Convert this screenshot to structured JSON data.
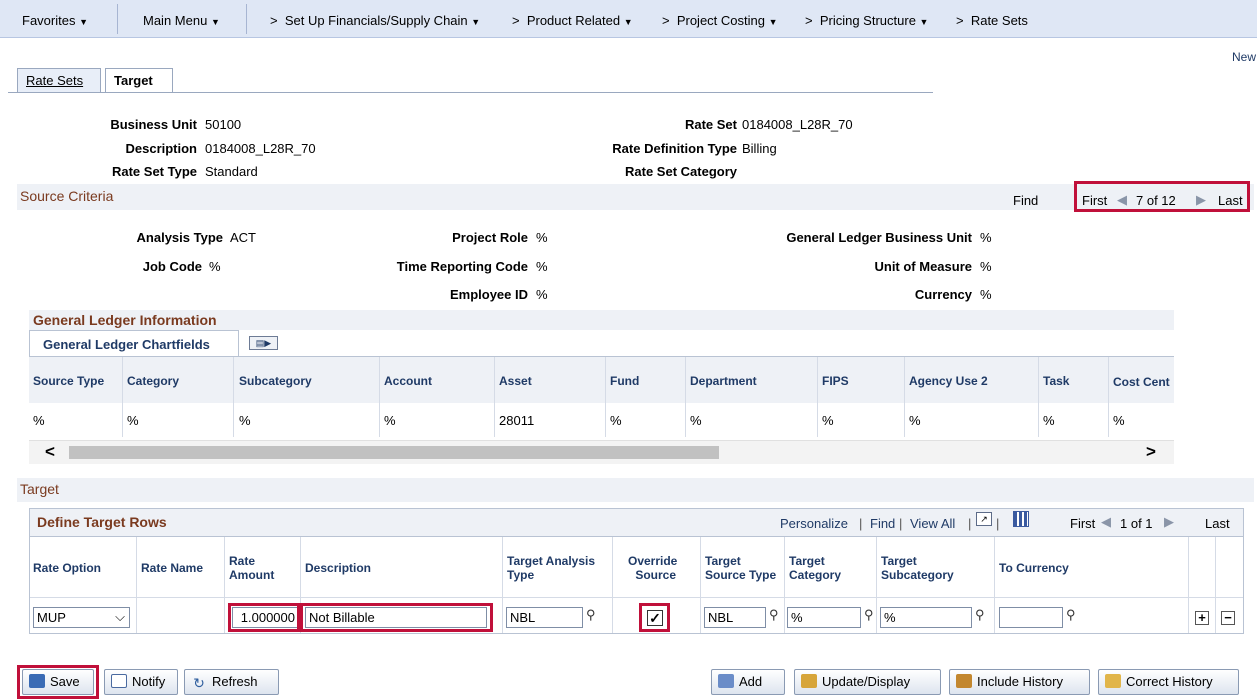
{
  "nav": {
    "favorites": "Favorites",
    "main_menu": "Main Menu",
    "breadcrumbs": [
      "Set Up Financials/Supply Chain",
      "Product Related",
      "Project Costing",
      "Pricing Structure",
      "Rate Sets"
    ],
    "new_window": "New"
  },
  "tabs": [
    {
      "label": "Rate Sets"
    },
    {
      "label": "Target"
    }
  ],
  "header": {
    "business_unit_label": "Business Unit",
    "business_unit": "50100",
    "description_label": "Description",
    "description": "0184008_L28R_70",
    "rate_set_type_label": "Rate Set Type",
    "rate_set_type": "Standard",
    "rate_set_label": "Rate Set",
    "rate_set": "0184008_L28R_70",
    "rate_def_type_label": "Rate Definition Type",
    "rate_def_type": "Billing",
    "rate_set_category_label": "Rate Set Category"
  },
  "source_criteria": {
    "title": "Source Criteria",
    "find": "Find",
    "first": "First",
    "counter": "7 of 12",
    "last": "Last",
    "analysis_type_label": "Analysis Type",
    "analysis_type": "ACT",
    "job_code_label": "Job Code",
    "job_code": "%",
    "project_role_label": "Project Role",
    "project_role": "%",
    "time_reporting_label": "Time Reporting Code",
    "time_reporting": "%",
    "employee_id_label": "Employee ID",
    "employee_id": "%",
    "gl_bu_label": "General Ledger Business Unit",
    "gl_bu": "%",
    "uom_label": "Unit of Measure",
    "uom": "%",
    "currency_label": "Currency",
    "currency": "%"
  },
  "gl_info": {
    "title": "General Ledger Information",
    "tab": "General Ledger Chartfields",
    "columns": [
      "Source Type",
      "Category",
      "Subcategory",
      "Account",
      "Asset",
      "Fund",
      "Department",
      "FIPS",
      "Agency Use 2",
      "Task",
      "Cost Cent"
    ],
    "row": [
      "%",
      "%",
      "%",
      "%",
      "28011",
      "%",
      "%",
      "%",
      "%",
      "%",
      "%"
    ]
  },
  "target": {
    "section_title": "Target",
    "grid_title": "Define Target Rows",
    "personalize": "Personalize",
    "find": "Find",
    "view_all": "View All",
    "first": "First",
    "counter": "1 of 1",
    "last": "Last",
    "columns": {
      "rate_option": "Rate Option",
      "rate_name": "Rate Name",
      "rate_amount_1": "Rate",
      "rate_amount_2": "Amount",
      "description": "Description",
      "tat_1": "Target Analysis",
      "tat_2": "Type",
      "ovr_1": "Override",
      "ovr_2": "Source",
      "tst_1": "Target",
      "tst_2": "Source Type",
      "tc_1": "Target",
      "tc_2": "Category",
      "tsc_1": "Target",
      "tsc_2": "Subcategory",
      "to_currency": "To Currency"
    },
    "row": {
      "rate_option": "MUP",
      "rate_amount": "1.000000",
      "description": "Not Billable",
      "target_analysis_type": "NBL",
      "override_source": true,
      "target_source_type": "NBL",
      "target_category": "%",
      "target_subcategory": "%",
      "to_currency": ""
    }
  },
  "buttons": {
    "save": "Save",
    "notify": "Notify",
    "refresh": "Refresh",
    "add": "Add",
    "update_display": "Update/Display",
    "include_history": "Include History",
    "correct_history": "Correct History"
  },
  "colors": {
    "highlight": "#c0103a",
    "section_title": "#7a3a1f",
    "nav_bg": "#dfe7f5"
  }
}
